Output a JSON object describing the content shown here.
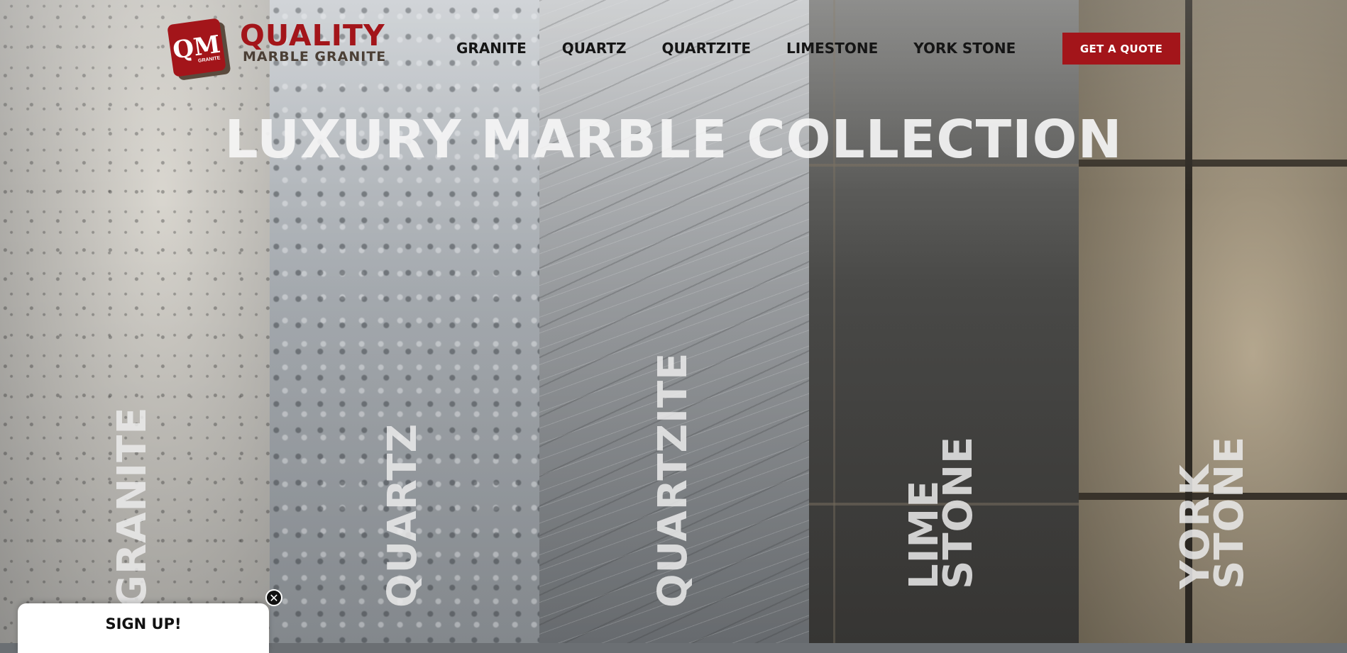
{
  "brand": {
    "logo_mark": "QM",
    "logo_mark_small": "GRANITE",
    "name_top": "QUALITY",
    "name_bottom": "MARBLE GRANITE",
    "accent_color": "#a3151a"
  },
  "nav": {
    "items": [
      "GRANITE",
      "QUARTZ",
      "QUARTZITE",
      "LIMESTONE",
      "YORK STONE"
    ],
    "cta_label": "GET A QUOTE"
  },
  "hero": {
    "title": "LUXURY MARBLE COLLECTION"
  },
  "panels": [
    {
      "label_lines": [
        "GRANITE"
      ]
    },
    {
      "label_lines": [
        "QUARTZ"
      ]
    },
    {
      "label_lines": [
        "QUARTZITE"
      ]
    },
    {
      "label_lines": [
        "LIME",
        "STONE"
      ]
    },
    {
      "label_lines": [
        "YORK",
        "STONE"
      ]
    }
  ],
  "signup": {
    "label": "SIGN UP!",
    "close_icon": "close-icon"
  }
}
